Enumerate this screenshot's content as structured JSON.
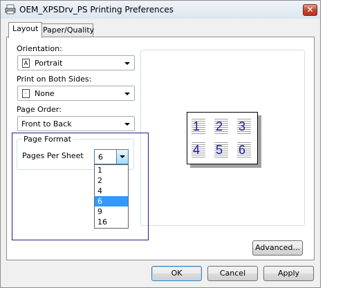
{
  "window": {
    "title": "OEM_XPSDrv_PS Printing Preferences",
    "close_label": "✕"
  },
  "tabs": [
    {
      "label": "Layout",
      "active": true
    },
    {
      "label": "Paper/Quality",
      "active": false
    }
  ],
  "orientation": {
    "label": "Orientation:",
    "value": "Portrait"
  },
  "duplex": {
    "label": "Print on Both Sides:",
    "value": "None"
  },
  "page_order": {
    "label": "Page Order:",
    "value": "Front to Back"
  },
  "page_format": {
    "group_label": "Page Format",
    "pages_per_sheet_label": "Pages Per Sheet",
    "pages_per_sheet_value": "6",
    "options": [
      "1",
      "2",
      "4",
      "6",
      "9",
      "16"
    ],
    "selected_option": "6"
  },
  "preview": {
    "page_numbers": [
      "1",
      "2",
      "3",
      "4",
      "5",
      "6"
    ]
  },
  "buttons": {
    "advanced": "Advanced...",
    "ok": "OK",
    "cancel": "Cancel",
    "apply": "Apply"
  },
  "colors": {
    "selection": "#3399ff",
    "preview_numbers": "#1a1aa8",
    "close_button": "#c4452f"
  }
}
